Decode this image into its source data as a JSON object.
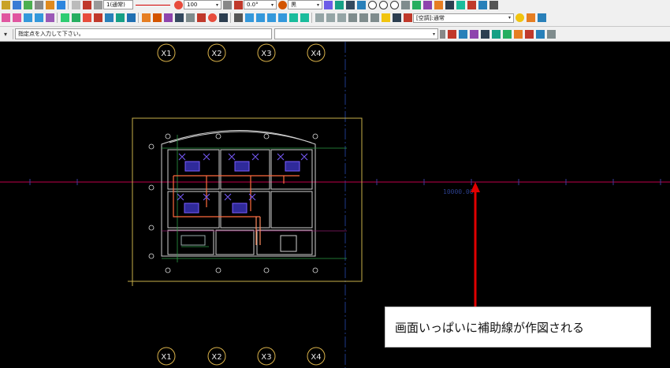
{
  "toolbar_top": {
    "line_type_value": "1(通常)",
    "scale_value": "100",
    "angle_value": "0.0°",
    "color_label": "黒",
    "icons": [
      "pointer-icon",
      "layer-icon",
      "undo-icon",
      "grid-icon",
      "snap-icon",
      "zoom-icon",
      "line-icon",
      "circle-icon",
      "arc-icon",
      "dimension-icon",
      "text-icon"
    ]
  },
  "toolbar_mid": {
    "layer_combo_value": "[空調]:通常",
    "icons": [
      "duct-icon",
      "pipe-icon",
      "fitting-icon",
      "equipment-icon",
      "valve-icon",
      "fan-icon",
      "sleeve-icon",
      "hanger-icon",
      "insulation-icon",
      "section-icon",
      "check-icon"
    ]
  },
  "command_bar": {
    "prompt_text": "指定点を入力して下さい。",
    "input_value": ""
  },
  "canvas": {
    "grid_labels_top": [
      "X1",
      "X2",
      "X3",
      "X4"
    ],
    "grid_labels_bottom": [
      "X1",
      "X2",
      "X3",
      "X4"
    ],
    "dimension_text": "10000.00",
    "colors": {
      "background": "#000000",
      "construction_line": "#c0004a",
      "grid_axis": "#1e3a8a",
      "grid_bubble": "#d9b24a",
      "arrow": "#e00000",
      "duct": "#ff6a3d",
      "equipment": "#7a5cff"
    }
  },
  "annotation": {
    "text": "画面いっぱいに補助線が作図される"
  }
}
